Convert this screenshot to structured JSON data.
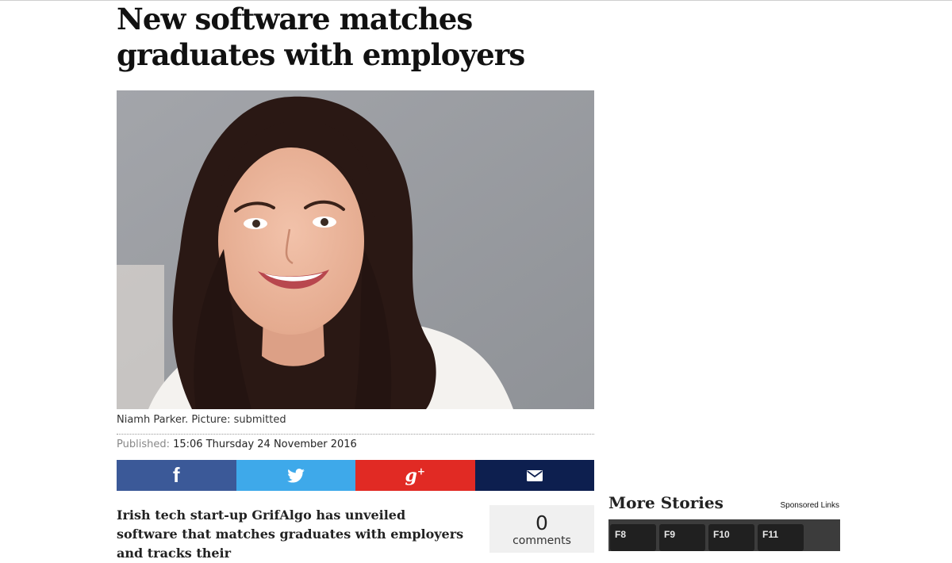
{
  "article": {
    "headline": "New software matches graduates with employers",
    "image_caption": "Niamh Parker. Picture: submitted",
    "published_label": "Published:",
    "published_value": "15:06 Thursday 24 November 2016",
    "lede": "Irish tech start-up GrifAlgo has unveiled software that matches graduates with employers and tracks their"
  },
  "share": {
    "buttons": [
      {
        "network": "facebook",
        "icon": "facebook-icon",
        "glyph": "f",
        "color": "#3b5998"
      },
      {
        "network": "twitter",
        "icon": "twitter-bird-icon",
        "color": "#3ea9ea"
      },
      {
        "network": "google-plus",
        "icon": "google-plus-icon",
        "glyph": "g",
        "glyph_sup": "+",
        "color": "#e12a24"
      },
      {
        "network": "email",
        "icon": "envelope-icon",
        "color": "#0d1f4f"
      }
    ]
  },
  "comments": {
    "count": "0",
    "label": "comments"
  },
  "sidebar": {
    "more_stories_title": "More Stories",
    "sponsored_label": "Sponsored Links",
    "thumbnail_keys": [
      "F8",
      "F9",
      "F10",
      "F11"
    ]
  }
}
